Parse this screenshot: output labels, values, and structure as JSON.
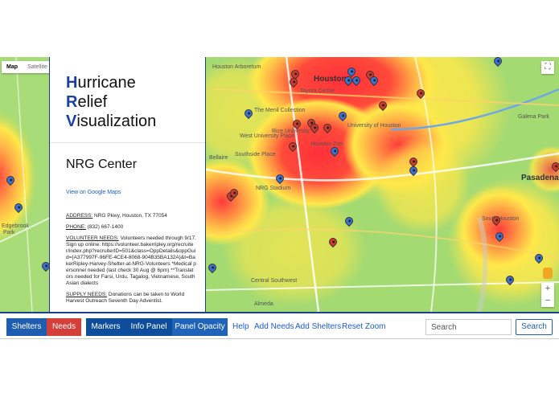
{
  "map": {
    "type_control": {
      "map_label": "Map",
      "satellite_label": "Satellite"
    },
    "labels": [
      "Houston Arboretum",
      "Houston",
      "Toyota Center",
      "The Menil Collection",
      "Rice University",
      "Houston Zoo",
      "University of Houston",
      "West University Place",
      "Southside Place",
      "Bellaire",
      "NRG Stadium",
      "Galena Park",
      "Pasadena",
      "South Houston",
      "Central Southwest",
      "Almeda",
      "Edgebrook",
      "Park"
    ],
    "fullscreen_icon": "fullscreen-icon",
    "zoom_in": "+",
    "zoom_out": "−"
  },
  "info": {
    "title_lines": [
      {
        "cap": "H",
        "rest": "urricane"
      },
      {
        "cap": "R",
        "rest": "elief"
      },
      {
        "cap": "V",
        "rest": "isualization"
      }
    ],
    "place_name": "NRG Center",
    "google_maps_link": "View on Google Maps",
    "address_label": "ADDRESS:",
    "address": "NRG Pkwy, Houston, TX 77054",
    "phone_label": "PHONE:",
    "phone": "(832) 667-1400",
    "volunteer_label": "VOLUNTEER NEEDS:",
    "volunteer": "Volunteers needed through 9/17. Sign up online: https://volunteer.bakerripley.org/recruiter/index.php?recruiterID=501&class=OppDetails&oppGuid={A377997F-96FE-4CE4-8068-904B35BA132A}&t=BakerRipley-Harvey-Shelter-at-NRG-Volunteers *Medical personnel needed (last check 30 Aug @ 6pm) **Translators needed for Farsi, Urdu, Tagalog, Vietnamese, South Asian dialects",
    "supply_label": "SUPPLY NEEDS:",
    "supply": "Donations can be taken to World Harvest Outreach Seventh Day Adventist."
  },
  "toolbar": {
    "shelters": "Shelters",
    "needs": "Needs",
    "markers": "Markers",
    "info_panel": "Info Panel",
    "panel_opacity": "Panel Opacity",
    "help": "Help",
    "add_needs": "Add Needs",
    "add_shelters": "Add Shelters",
    "reset_zoom": "Reset Zoom",
    "search_placeholder": "Search",
    "search_button": "Search"
  },
  "colors": {
    "accent": "#1e5db0",
    "needs": "#d43f3a",
    "heat_red": "#ff3b3b",
    "heat_yellow": "#ffe84a",
    "heat_green": "#9cd66e"
  }
}
